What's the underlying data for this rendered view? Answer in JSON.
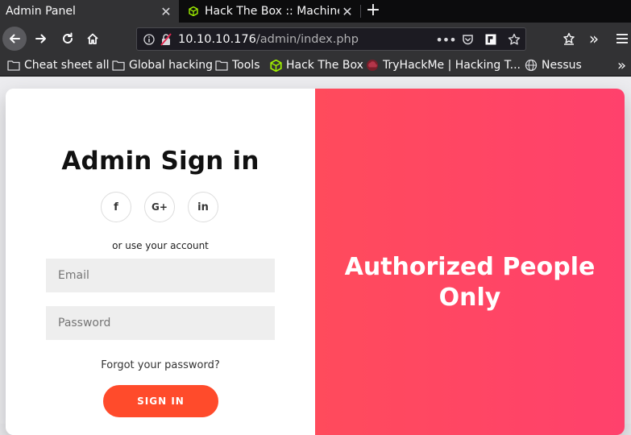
{
  "tabs": [
    {
      "title": "Admin Panel",
      "active": true
    },
    {
      "title": "Hack The Box :: Machines",
      "active": false
    }
  ],
  "toolbar": {
    "url_host": "10.10.10.176",
    "url_path": "/admin/index.php"
  },
  "bookmarks": [
    {
      "label": "Cheat sheet all",
      "icon": "folder-icon"
    },
    {
      "label": "Global hacking",
      "icon": "folder-icon"
    },
    {
      "label": "Tools",
      "icon": "folder-icon"
    },
    {
      "label": "Hack The Box",
      "icon": "cube-icon"
    },
    {
      "label": "TryHackMe | Hacking T...",
      "icon": "tryhackme-icon"
    },
    {
      "label": "Nessus",
      "icon": "globe-icon"
    }
  ],
  "login": {
    "heading": "Admin Sign in",
    "social": [
      {
        "label": "f",
        "icon": "facebook-icon"
      },
      {
        "label": "G+",
        "icon": "google-plus-icon"
      },
      {
        "label": "in",
        "icon": "linkedin-icon"
      }
    ],
    "or_text": "or use your account",
    "email_placeholder": "Email",
    "password_placeholder": "Password",
    "forgot_text": "Forgot your password?",
    "signin_label": "SIGN IN"
  },
  "overlay": {
    "line1": "Authorized People",
    "line2": "Only"
  },
  "colors": {
    "overlay_gradient_start": "#ff4b5c",
    "overlay_gradient_end": "#ff416c",
    "signin_button": "#ff4b2b"
  }
}
